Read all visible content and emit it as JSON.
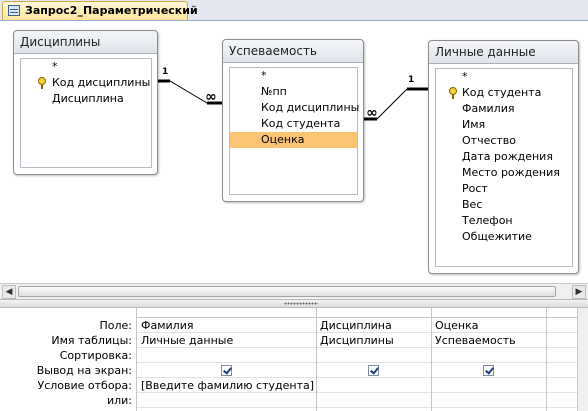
{
  "tab": {
    "title": "Запрос2_Параметрический",
    "icon": "query-icon"
  },
  "tables": {
    "disc": {
      "title": "Дисциплины",
      "fields": [
        "*",
        "Код дисциплины",
        "Дисциплина"
      ],
      "key_field": "Код дисциплины"
    },
    "usp": {
      "title": "Успеваемость",
      "fields": [
        "*",
        "№пп",
        "Код дисциплины",
        "Код студента",
        "Оценка"
      ],
      "selected_field": "Оценка"
    },
    "lich": {
      "title": "Личные данные",
      "fields": [
        "*",
        "Код студента",
        "Фамилия",
        "Имя",
        "Отчество",
        "Дата рождения",
        "Место рождения",
        "Рост",
        "Вес",
        "Телефон",
        "Общежитие"
      ],
      "key_field": "Код студента"
    }
  },
  "relations": {
    "one_label": "1",
    "many_label": "∞"
  },
  "grid": {
    "row_labels": [
      "Поле:",
      "Имя таблицы:",
      "Сортировка:",
      "Вывод на экран:",
      "Условие отбора:",
      "или:"
    ],
    "columns": [
      {
        "field": "Фамилия",
        "table": "Личные данные",
        "sort": "",
        "show": true,
        "criteria": "[Введите фамилию студента]",
        "or": ""
      },
      {
        "field": "Дисциплина",
        "table": "Дисциплины",
        "sort": "",
        "show": true,
        "criteria": "",
        "or": ""
      },
      {
        "field": "Оценка",
        "table": "Успеваемость",
        "sort": "",
        "show": true,
        "criteria": "",
        "or": ""
      }
    ]
  },
  "colors": {
    "selected_field": "#fbc374",
    "tab_active": "#ffe59a"
  }
}
